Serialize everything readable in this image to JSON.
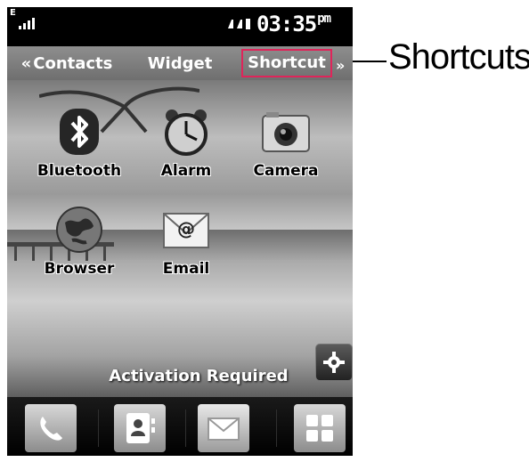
{
  "status_bar": {
    "network_type": "E",
    "signal_level": 0.8,
    "time": "03:35",
    "ampm": "pm"
  },
  "nav_tabs": {
    "left": "Contacts",
    "center": "Widget",
    "active": "Shortcut"
  },
  "apps": [
    {
      "label": "Bluetooth",
      "icon": "bluetooth-icon"
    },
    {
      "label": "Alarm",
      "icon": "alarm-clock-icon"
    },
    {
      "label": "Camera",
      "icon": "camera-icon"
    },
    {
      "label": "Browser",
      "icon": "globe-icon"
    },
    {
      "label": "Email",
      "icon": "email-icon"
    }
  ],
  "activation_notice": "Activation Required",
  "dock": [
    {
      "icon": "phone-icon"
    },
    {
      "icon": "contacts-icon"
    },
    {
      "icon": "message-icon"
    },
    {
      "icon": "menu-grid-icon"
    }
  ],
  "callout": {
    "label": "Shortcuts"
  },
  "colors": {
    "highlight_border": "#e0245a",
    "screen_background": "#000000"
  }
}
